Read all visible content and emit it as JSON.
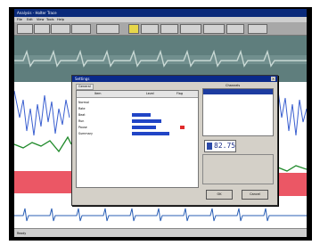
{
  "app": {
    "title": "Analysis - Holter Trace",
    "menu": [
      "File",
      "Edit",
      "View",
      "Tools",
      "Help"
    ],
    "toolbar_buttons": [
      "",
      "",
      "",
      "",
      "",
      "",
      "",
      "",
      "",
      "",
      "",
      ""
    ]
  },
  "dialog": {
    "title": "Settings",
    "tab": "General",
    "close_glyph": "×",
    "table_headers": [
      "Item",
      "Level",
      "Flag"
    ],
    "rows": [
      {
        "label": "Normal",
        "level": 0.0,
        "flag": false
      },
      {
        "label": "Rate",
        "level": 0.0,
        "flag": false
      },
      {
        "label": "Beat",
        "level": 0.35,
        "flag": false
      },
      {
        "label": "Run",
        "level": 0.55,
        "flag": false
      },
      {
        "label": "Pause",
        "level": 0.45,
        "flag": true
      },
      {
        "label": "Summary",
        "level": 0.7,
        "flag": false
      }
    ],
    "list_label": "Channels",
    "list_items": [
      "",
      "",
      "",
      "",
      "",
      "",
      ""
    ],
    "selected_index": 0,
    "readout_value": "82.75",
    "options": [
      "",
      "",
      "",
      "",
      ""
    ],
    "ok_label": "OK",
    "cancel_label": "Cancel"
  },
  "status": {
    "left": "Ready",
    "middle": "",
    "right": ""
  },
  "colors": {
    "trace_blue": "#3a5fd0",
    "trace_green": "#1f8a2a",
    "trace_red": "#e8394a",
    "accent_dark_blue": "#1d3ca0"
  }
}
